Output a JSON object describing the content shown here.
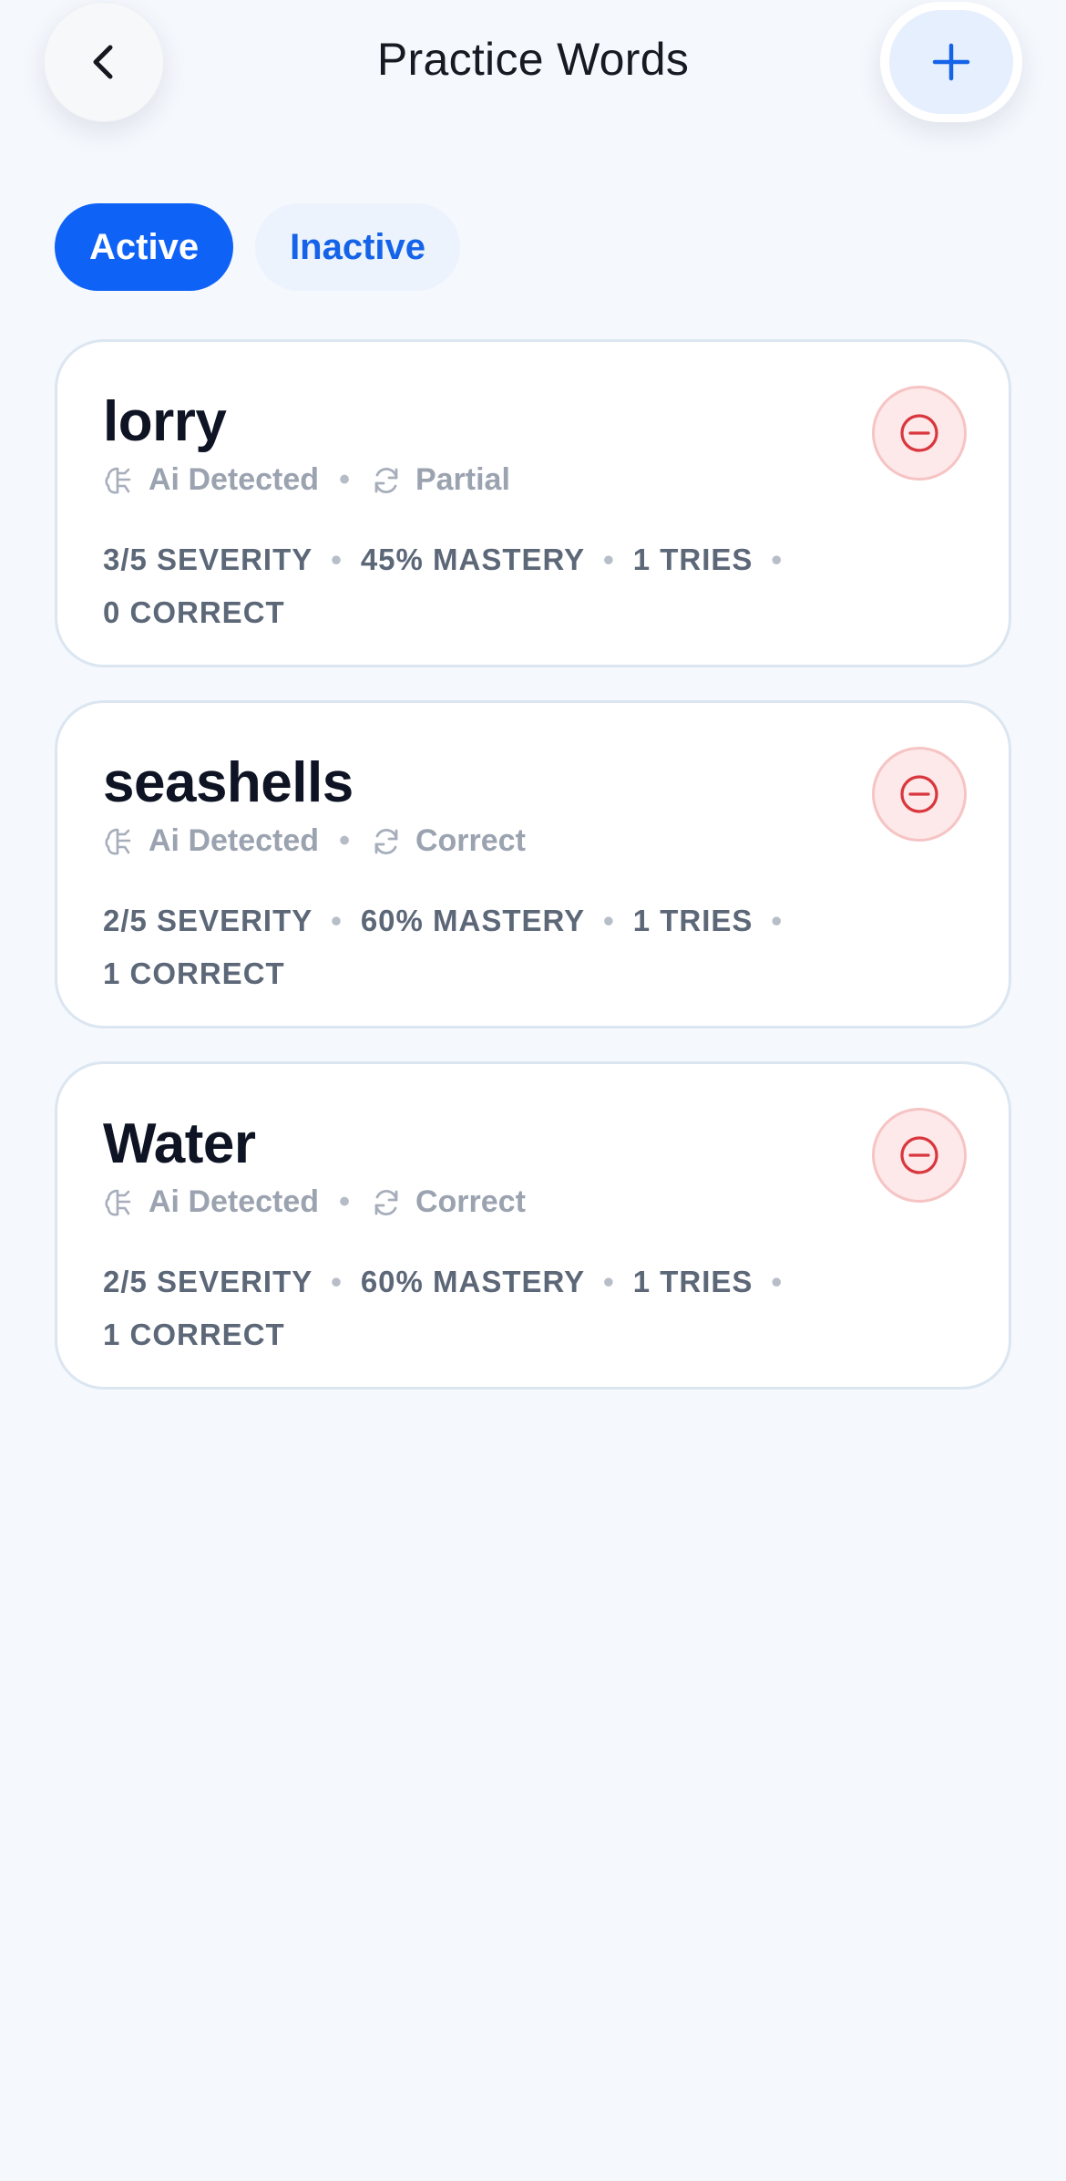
{
  "header": {
    "title": "Practice Words",
    "back_icon": "chevron-left-icon",
    "add_icon": "plus-icon"
  },
  "tabs": [
    {
      "label": "Active",
      "selected": true
    },
    {
      "label": "Inactive",
      "selected": false
    }
  ],
  "colors": {
    "accent": "#0f62f6",
    "remove": "#d9363e",
    "background": "#f5f8fd"
  },
  "words": [
    {
      "word": "lorry",
      "source": "Ai Detected",
      "status": "Partial",
      "severity": "3/5 SEVERITY",
      "mastery": "45% MASTERY",
      "tries": "1 TRIES",
      "correct": "0 CORRECT"
    },
    {
      "word": "seashells",
      "source": "Ai Detected",
      "status": "Correct",
      "severity": "2/5 SEVERITY",
      "mastery": "60% MASTERY",
      "tries": "1 TRIES",
      "correct": "1 CORRECT"
    },
    {
      "word": "Water",
      "source": "Ai Detected",
      "status": "Correct",
      "severity": "2/5 SEVERITY",
      "mastery": "60% MASTERY",
      "tries": "1 TRIES",
      "correct": "1 CORRECT"
    }
  ]
}
